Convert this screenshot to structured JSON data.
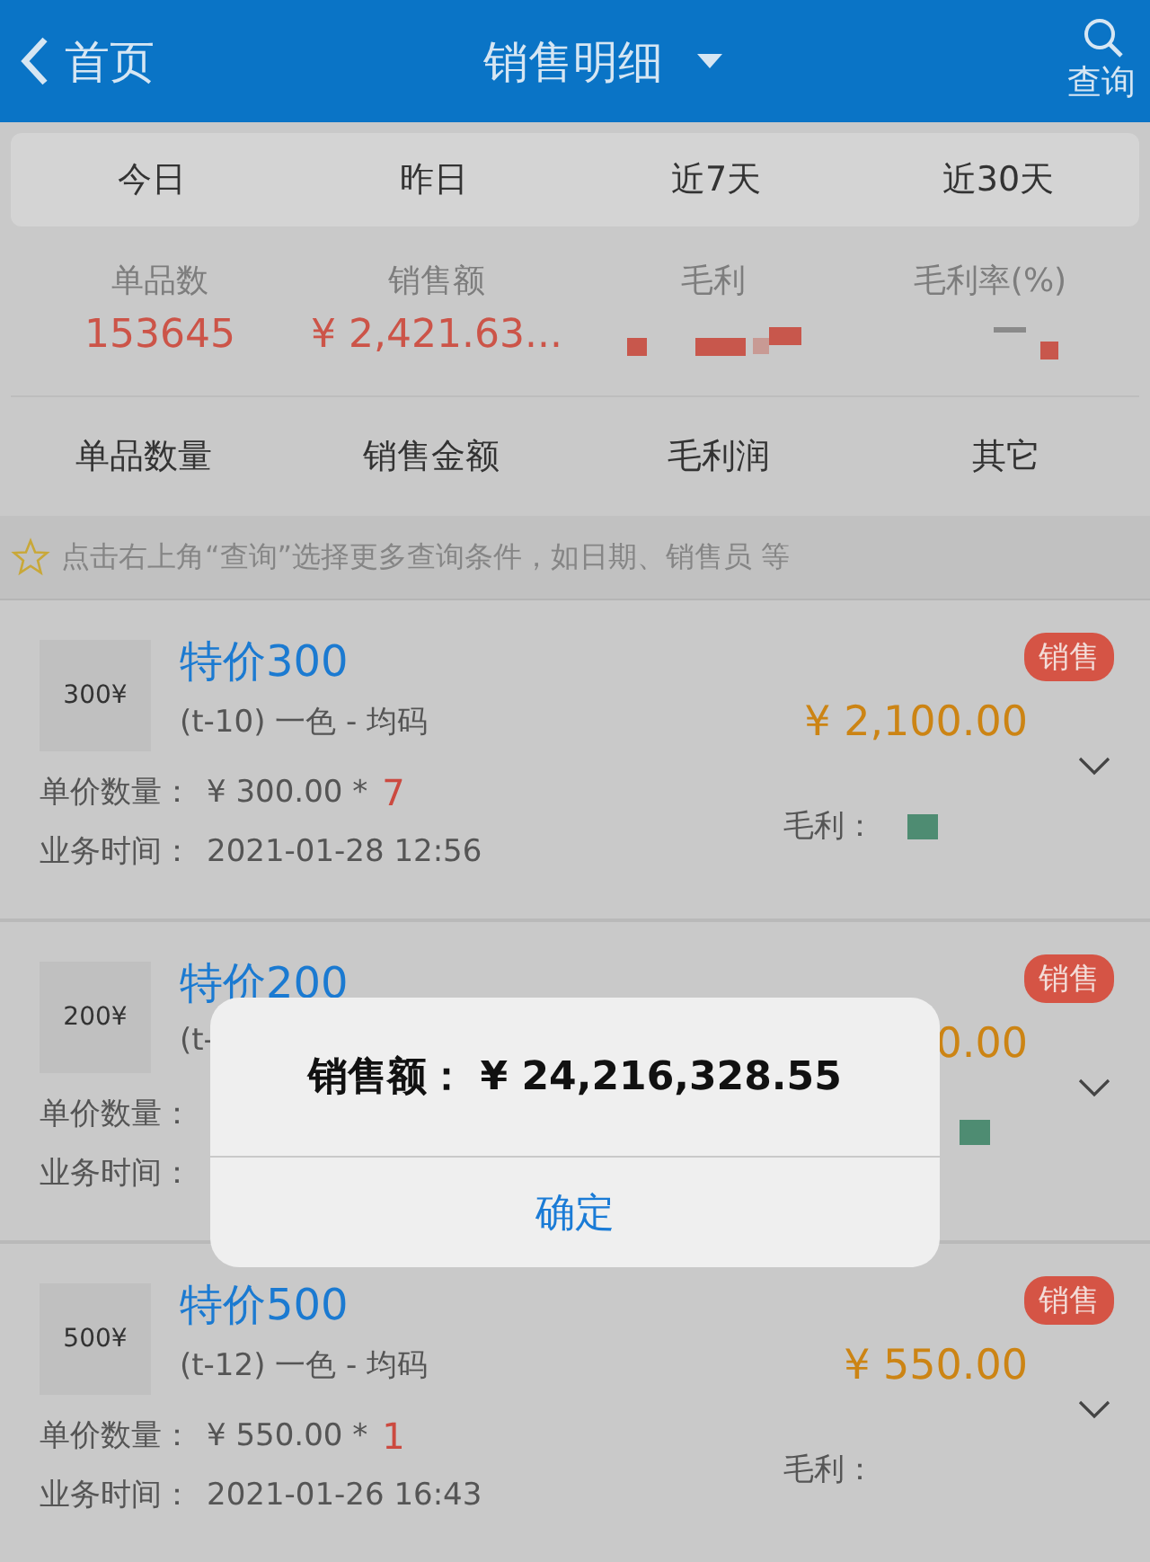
{
  "header": {
    "back_label": "首页",
    "title": "销售明细",
    "search_label": "查询"
  },
  "period_tabs": [
    {
      "label": "今日"
    },
    {
      "label": "昨日"
    },
    {
      "label": "近7天"
    },
    {
      "label": "近30天"
    }
  ],
  "stats": [
    {
      "label": "单品数",
      "value": "153645",
      "redacted": false
    },
    {
      "label": "销售额",
      "value": "¥ 2,421.63...",
      "redacted": false
    },
    {
      "label": "毛利",
      "redacted": true
    },
    {
      "label": "毛利率(%)",
      "redacted": true
    }
  ],
  "sort_tabs": [
    {
      "label": "单品数量"
    },
    {
      "label": "销售金额"
    },
    {
      "label": "毛利润"
    },
    {
      "label": "其它"
    }
  ],
  "hint": "点击右上角“查询”选择更多查询条件，如日期、销售员 等",
  "items": [
    {
      "thumb": "300¥",
      "title": "特价300",
      "sku": "(t-10) 一色 - 均码",
      "badge": "销售",
      "price": "¥ 2,100.00",
      "unit_label": "单价数量：",
      "unit_price": "¥ 300.00 *",
      "qty": "7",
      "time_label": "业务时间：",
      "time": "2021-01-28 12:56",
      "profit_label": "毛利：",
      "profit_redacted": true
    },
    {
      "thumb": "200¥",
      "title": "特价200",
      "sku": "(t-",
      "badge": "销售",
      "price": "0.00",
      "unit_label": "单价数量：",
      "time_label": "业务时间：",
      "profit_redacted": true
    },
    {
      "thumb": "500¥",
      "title": "特价500",
      "sku": "(t-12) 一色 - 均码",
      "badge": "销售",
      "price": "¥ 550.00",
      "unit_label": "单价数量：",
      "unit_price": "¥ 550.00 *",
      "qty": "1",
      "time_label": "业务时间：",
      "time": "2021-01-26 16:43",
      "profit_label": "毛利：",
      "profit_redacted": false
    }
  ],
  "dialog": {
    "message": "销售额： ¥ 24,216,328.55",
    "button": "确定"
  }
}
